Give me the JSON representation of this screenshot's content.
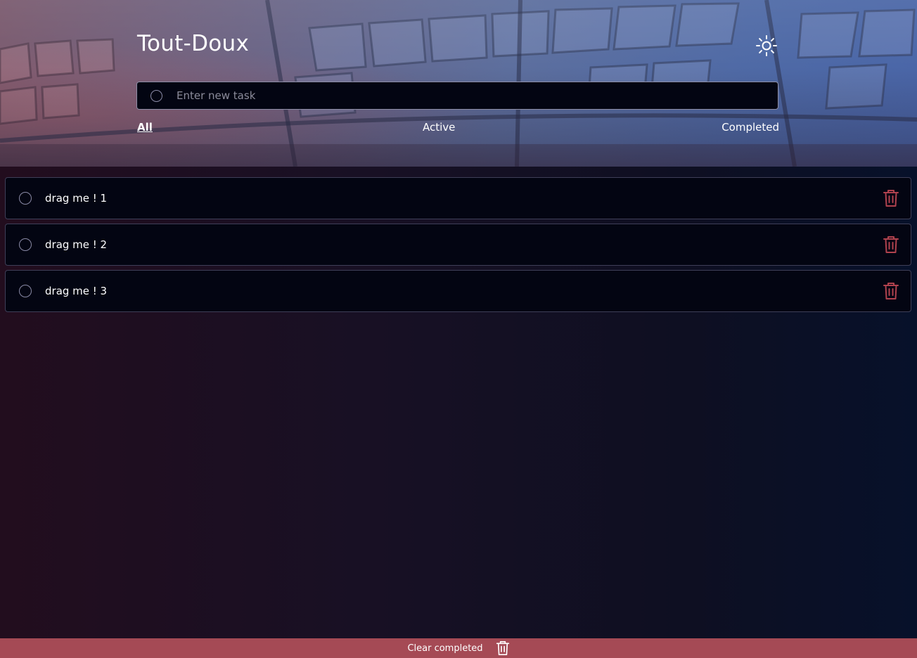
{
  "app": {
    "title": "Tout-Doux",
    "theme_toggle_icon": "sun-icon"
  },
  "new_task": {
    "placeholder": "Enter new task",
    "value": ""
  },
  "filters": [
    {
      "label": "All",
      "active": true
    },
    {
      "label": "Active",
      "active": false
    },
    {
      "label": "Completed",
      "active": false
    }
  ],
  "tasks": [
    {
      "text": "drag me ! 1",
      "completed": false,
      "delete_icon": "trash-icon"
    },
    {
      "text": "drag me ! 2",
      "completed": false,
      "delete_icon": "trash-icon"
    },
    {
      "text": "drag me ! 3",
      "completed": false,
      "delete_icon": "trash-icon"
    }
  ],
  "footer": {
    "clear_label": "Clear completed",
    "clear_icon": "trash-icon"
  },
  "colors": {
    "accent_danger": "#a54a55",
    "task_bg": "#030512",
    "delete_icon": "#b0424e"
  }
}
